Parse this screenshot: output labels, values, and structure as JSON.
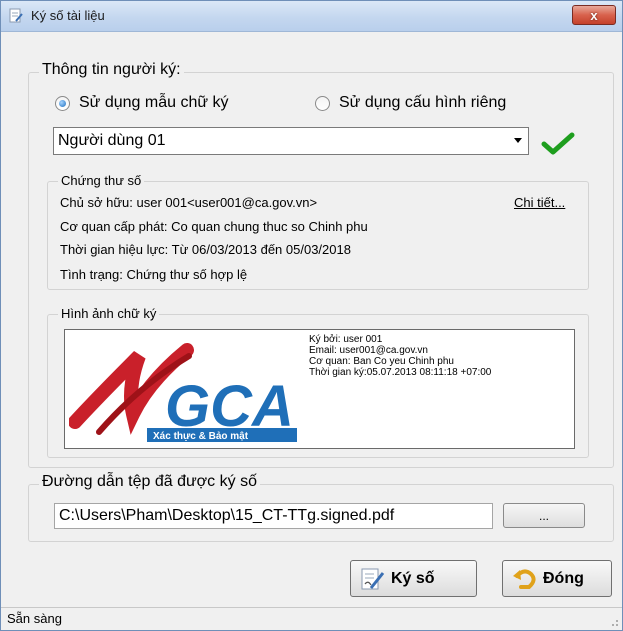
{
  "window": {
    "title": "Ký số tài liệu",
    "close_label": "x"
  },
  "signer_info": {
    "legend": "Thông tin người ký:",
    "radio_template": "Sử dụng mẫu chữ ký",
    "radio_custom": "Sử dụng cấu hình riêng",
    "selected_option": "radio_template",
    "dropdown_value": "Người dùng 01"
  },
  "certificate": {
    "legend": "Chứng thư số",
    "owner": "Chủ sở hữu: user 001<user001@ca.gov.vn>",
    "details_link": "Chi tiết...",
    "issuer": "Cơ quan cấp phát: Co quan chung thuc so Chinh phu",
    "validity": "Thời gian hiệu lực: Từ 06/03/2013 đến 05/03/2018",
    "status": "Tình trạng: Chứng thư số hợp lệ"
  },
  "signature_image": {
    "legend": "Hình ảnh chữ ký",
    "logo_text": "GCA",
    "logo_tagline": "Xác thực & Bảo mật",
    "signed_by": "Ký bởi: user 001",
    "email": "Email: user001@ca.gov.vn",
    "agency": "Cơ quan: Ban Co yeu Chinh phu",
    "signed_time": "Thời gian ký:05.07.2013 08:11:18 +07:00"
  },
  "output": {
    "legend": "Đường dẫn tệp đã được ký số",
    "path_value": "C:\\Users\\Pham\\Desktop\\15_CT-TTg.signed.pdf",
    "browse_label": "..."
  },
  "actions": {
    "sign_label": "Ký số",
    "close_label": "Đóng"
  },
  "status_bar": {
    "text": "Sẵn sàng"
  },
  "colors": {
    "accent_check": "#1e9e1e",
    "title_gradient": "#c4d7ef",
    "close_red": "#c5412b"
  }
}
